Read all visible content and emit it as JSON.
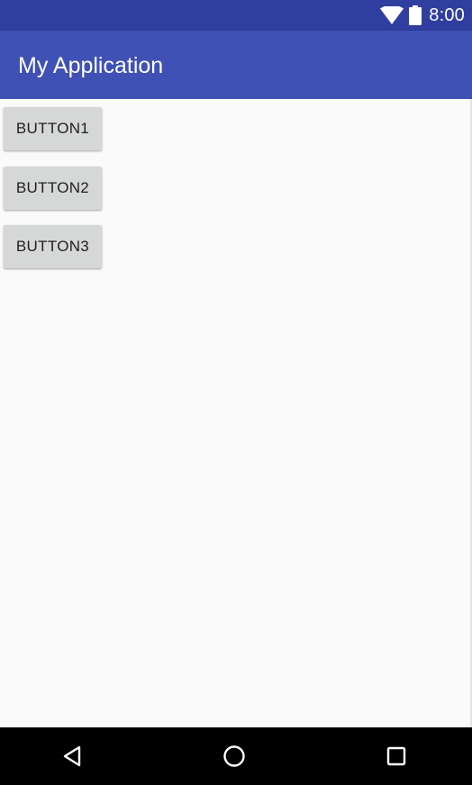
{
  "status_bar": {
    "time": "8:00",
    "icons": [
      "wifi-icon",
      "battery-icon"
    ],
    "color": "#303f9f"
  },
  "app_bar": {
    "title": "My Application",
    "color": "#3f51b5"
  },
  "buttons": [
    {
      "label": "BUTTON1"
    },
    {
      "label": "BUTTON2"
    },
    {
      "label": "BUTTON3"
    }
  ],
  "nav_bar": {
    "icons": [
      "back-icon",
      "home-icon",
      "recents-icon"
    ],
    "color": "#000000"
  }
}
